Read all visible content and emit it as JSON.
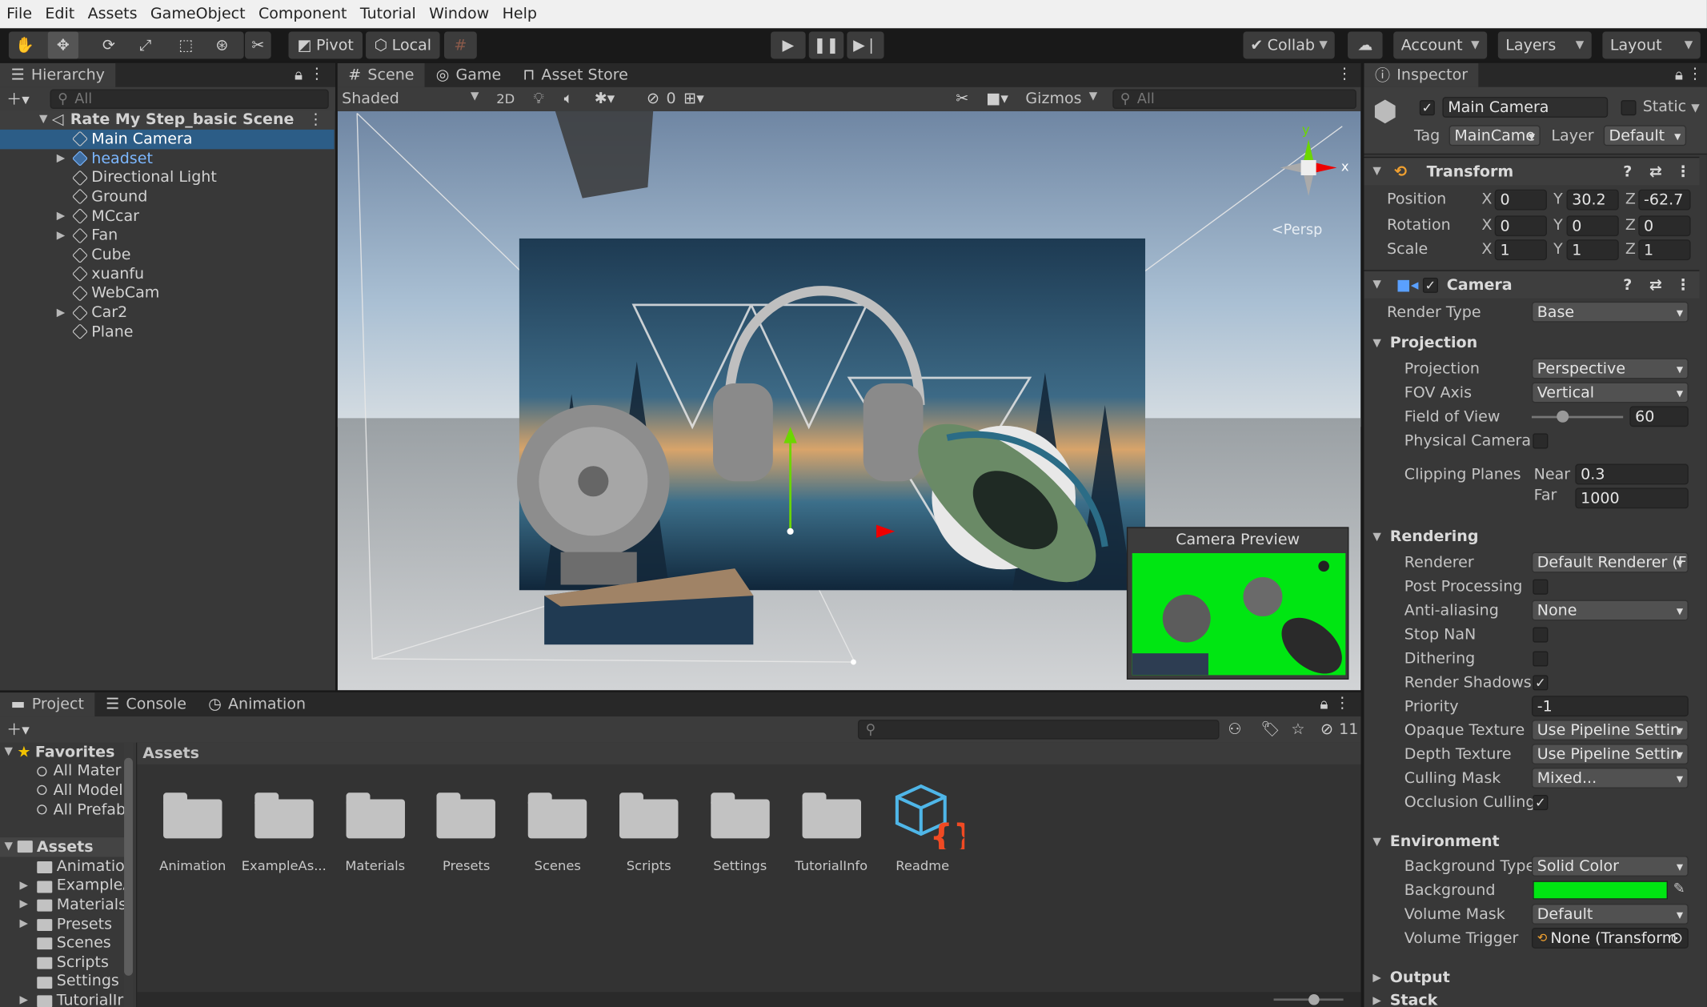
{
  "menu": [
    "File",
    "Edit",
    "Assets",
    "GameObject",
    "Component",
    "Tutorial",
    "Window",
    "Help"
  ],
  "toolbar": {
    "tools": [
      "hand-tool-icon",
      "move-tool-icon",
      "rotate-tool-icon",
      "scale-tool-icon",
      "rect-tool-icon",
      "transform-tool-icon",
      "custom-tool-icon"
    ],
    "pivot": "Pivot",
    "local": "Local",
    "collab": "Collab",
    "account": "Account",
    "layers": "Layers",
    "layout": "Layout"
  },
  "hierarchy": {
    "tab": "Hierarchy",
    "search_placeholder": "All",
    "scene": "Rate My Step_basic Scene",
    "items": [
      {
        "label": "Main Camera",
        "expandable": false,
        "selected": true
      },
      {
        "label": "headset",
        "expandable": true,
        "prefab": true
      },
      {
        "label": "Directional Light",
        "expandable": false
      },
      {
        "label": "Ground",
        "expandable": false
      },
      {
        "label": "MCcar",
        "expandable": true
      },
      {
        "label": "Fan",
        "expandable": true
      },
      {
        "label": "Cube",
        "expandable": false
      },
      {
        "label": "xuanfu",
        "expandable": false
      },
      {
        "label": "WebCam",
        "expandable": false
      },
      {
        "label": "Car2",
        "expandable": true
      },
      {
        "label": "Plane",
        "expandable": false
      }
    ]
  },
  "scene_view": {
    "tabs": [
      "Scene",
      "Game",
      "Asset Store"
    ],
    "shading": "Shaded",
    "mode_2d": "2D",
    "hidden_count": "0",
    "gizmos": "Gizmos",
    "search_placeholder": "All",
    "persp_label": "Persp",
    "gizmo_axes": {
      "y": "y",
      "x": "x"
    },
    "camera_preview_title": "Camera Preview"
  },
  "project": {
    "tabs": [
      "Project",
      "Console",
      "Animation"
    ],
    "hidden_count": "11",
    "favorites_label": "Favorites",
    "favorites": [
      "All Mater",
      "All Model",
      "All Prefab"
    ],
    "assets_label": "Assets",
    "asset_tree": [
      {
        "label": "Animation",
        "expandable": false
      },
      {
        "label": "ExampleA",
        "expandable": true
      },
      {
        "label": "Materials",
        "expandable": true
      },
      {
        "label": "Presets",
        "expandable": true
      },
      {
        "label": "Scenes",
        "expandable": false
      },
      {
        "label": "Scripts",
        "expandable": false
      },
      {
        "label": "Settings",
        "expandable": false
      },
      {
        "label": "TutorialIr",
        "expandable": true
      }
    ],
    "breadcrumb": "Assets",
    "grid": [
      "Animation",
      "ExampleAs...",
      "Materials",
      "Presets",
      "Scenes",
      "Scripts",
      "Settings",
      "TutorialInfo",
      "Readme"
    ]
  },
  "inspector": {
    "tab": "Inspector",
    "object_name": "Main Camera",
    "static_label": "Static",
    "tag_label": "Tag",
    "tag_value": "MainCame",
    "layer_label": "Layer",
    "layer_value": "Default",
    "transform": {
      "title": "Transform",
      "position": {
        "label": "Position",
        "x": "0",
        "y": "30.2",
        "z": "-62.7"
      },
      "rotation": {
        "label": "Rotation",
        "x": "0",
        "y": "0",
        "z": "0"
      },
      "scale": {
        "label": "Scale",
        "x": "1",
        "y": "1",
        "z": "1"
      }
    },
    "camera": {
      "title": "Camera",
      "render_type_label": "Render Type",
      "render_type": "Base",
      "projection_section": "Projection",
      "projection_label": "Projection",
      "projection": "Perspective",
      "fov_axis_label": "FOV Axis",
      "fov_axis": "Vertical",
      "fov_label": "Field of View",
      "fov_value": "60",
      "fov_fraction": 0.33,
      "physical_camera_label": "Physical Camera",
      "physical_camera": false,
      "clipping_label": "Clipping Planes",
      "near_label": "Near",
      "near": "0.3",
      "far_label": "Far",
      "far": "1000",
      "rendering_section": "Rendering",
      "renderer_label": "Renderer",
      "renderer": "Default Renderer (F",
      "post_processing_label": "Post Processing",
      "post_processing": false,
      "anti_aliasing_label": "Anti-aliasing",
      "anti_aliasing": "None",
      "stop_nan_label": "Stop NaN",
      "stop_nan": false,
      "dithering_label": "Dithering",
      "dithering": false,
      "render_shadows_label": "Render Shadows",
      "render_shadows": true,
      "priority_label": "Priority",
      "priority": "-1",
      "opaque_texture_label": "Opaque Texture",
      "opaque_texture": "Use Pipeline Settin",
      "depth_texture_label": "Depth Texture",
      "depth_texture": "Use Pipeline Settin",
      "culling_mask_label": "Culling Mask",
      "culling_mask": "Mixed...",
      "occlusion_label": "Occlusion Culling",
      "occlusion": true,
      "environment_section": "Environment",
      "bg_type_label": "Background Type",
      "bg_type": "Solid Color",
      "background_label": "Background",
      "background_color": "#00e612",
      "volume_mask_label": "Volume Mask",
      "volume_mask": "Default",
      "volume_trigger_label": "Volume Trigger",
      "volume_trigger": "None (Transform",
      "output_section": "Output",
      "stack_section": "Stack"
    }
  },
  "colors": {
    "selection": "#2c5d87",
    "prefab_blue": "#7cb7ff",
    "accent_green": "#00e612"
  }
}
